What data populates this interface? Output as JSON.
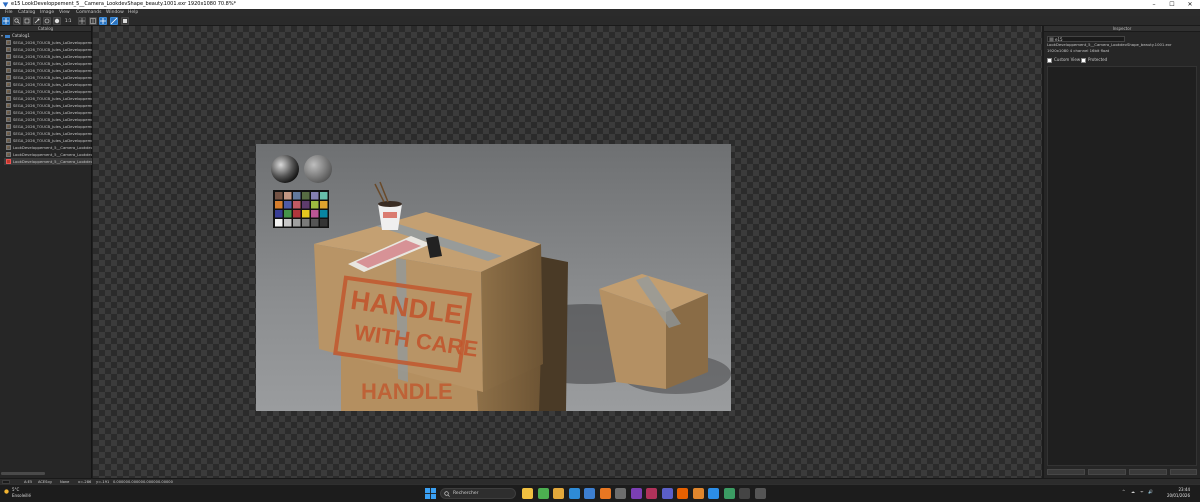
{
  "window": {
    "title": "e15 LookDeveloppement_5__Camera_LookdevShape_beauty.1001.exr 1920x1080 70.8%*",
    "minimize": "–",
    "maximize": "☐",
    "close": "✕"
  },
  "menu": [
    "File",
    "Catalog",
    "Image",
    "View",
    "Commands",
    "Window",
    "Help"
  ],
  "toolbar": {
    "icons": [
      "select-icon",
      "zoom-icon",
      "pan-icon",
      "color-picker-icon",
      "compare-icon",
      "fit-icon",
      "ratio-label",
      "flip-icon",
      "split-icon",
      "export-icon",
      "grid-icon",
      "wipe-icon",
      "snapshot-icon"
    ],
    "ratio_label": "1:1"
  },
  "catalog": {
    "header": "Catalog",
    "root_label": "Catalog1",
    "items": [
      "SEGA_2026_TOUCB_Jules_LoDeveloppement",
      "SEGA_2026_TOUCB_Jules_LoDeveloppement",
      "SEGA_2026_TOUCB_Jules_LoDeveloppement",
      "SEGA_2026_TOUCB_Jules_LoDeveloppement",
      "SEGA_2026_TOUCB_Jules_LoDeveloppement",
      "SEGA_2026_TOUCB_Jules_LoDeveloppement",
      "SEGA_2026_TOUCB_Jules_LoDeveloppement",
      "SEGA_2026_TOUCB_Jules_LoDeveloppement",
      "SEGA_2026_TOUCB_Jules_LoDeveloppement",
      "SEGA_2026_TOUCB_Jules_LoDeveloppement",
      "SEGA_2026_TOUCB_Jules_LoDeveloppement",
      "SEGA_2026_TOUCB_Jules_LoDeveloppement",
      "SEGA_2026_TOUCB_Jules_LoDeveloppement",
      "SEGA_2026_TOUCB_Jules_LoDeveloppement",
      "SEGA_2026_TOUCB_Jules_LoDeveloppement",
      "LookDeveloppement_5__Camera_LookdevSh",
      "LookDeveloppement_5__Camera_LookdevSh",
      "LookDeveloppement_5__Camera_LookdevSh"
    ],
    "selected_index": 17
  },
  "viewer": {
    "render_labels": {
      "box_stamp_line1": "HANDLE",
      "box_stamp_line2": "WITH CARE",
      "box_bottom_stamp": "HANDLE"
    },
    "colors": {
      "background": "#3b3b3b",
      "render_bg": "#7f8284",
      "cardboard": "#b89466",
      "stamp": "#c1572e"
    }
  },
  "inspector": {
    "header": "Inspector",
    "search_value": "e15",
    "file_name": "LookDeveloppement_5__Camera_LookdevShape_beauty.1001.exr",
    "file_info": "1920x1080 4 channel 16bit float",
    "custom_view_label": "Custom View",
    "protected_label": "Protected"
  },
  "statusbar": {
    "fields": [
      "A:E5",
      "ACEScg",
      "None",
      "x=-286",
      "y=-191",
      "0.00000",
      "0.00000",
      "0.00000",
      "0.00000"
    ]
  },
  "taskbar": {
    "weather_temp": "5°C",
    "weather_desc": "Ensoleillé",
    "search_placeholder": "Rechercher",
    "time": "23:44",
    "date": "20/01/2026",
    "apps": [
      {
        "name": "file-explorer-icon",
        "color": "#f0c040"
      },
      {
        "name": "chrome-icon",
        "color": "#4caf50"
      },
      {
        "name": "folder-icon",
        "color": "#e3a83b"
      },
      {
        "name": "edge-icon",
        "color": "#2e8bd6"
      },
      {
        "name": "store-icon",
        "color": "#3d7fd1"
      },
      {
        "name": "vlc-icon",
        "color": "#e87722"
      },
      {
        "name": "mail-icon",
        "color": "#6d6d6d"
      },
      {
        "name": "app-purple-icon",
        "color": "#7b3fb3"
      },
      {
        "name": "mrviewer-icon",
        "color": "#b0325a"
      },
      {
        "name": "teams-icon",
        "color": "#5b5fc7"
      },
      {
        "name": "firefox-icon",
        "color": "#e66000"
      },
      {
        "name": "blender-icon",
        "color": "#e0862d"
      },
      {
        "name": "photoshop-icon",
        "color": "#2c8ee8"
      },
      {
        "name": "app-green-icon",
        "color": "#3b9c63"
      },
      {
        "name": "terminal-icon",
        "color": "#444"
      },
      {
        "name": "app-active-icon",
        "color": "#555"
      }
    ],
    "tray": [
      "^",
      "☁",
      "ᯤ",
      "🔊"
    ]
  }
}
